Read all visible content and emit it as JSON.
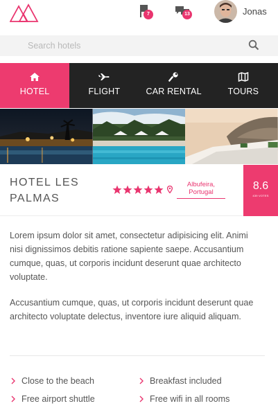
{
  "header": {
    "logo": "triangles-logo",
    "flag_badge": "7",
    "messages_badge": "13",
    "username": "Jonas"
  },
  "search": {
    "placeholder": "Search hotels"
  },
  "tabs": [
    {
      "label": "HOTEL",
      "icon": "home-icon",
      "active": true
    },
    {
      "label": "FLIGHT",
      "icon": "plane-icon",
      "active": false
    },
    {
      "label": "CAR RENTAL",
      "icon": "wrench-icon",
      "active": false
    },
    {
      "label": "TOURS",
      "icon": "map-icon",
      "active": false
    }
  ],
  "hotel": {
    "name": "HOTEL LES PALMAS",
    "stars": 5,
    "location": "Albufeira, Portugal",
    "score": "8.6",
    "votes_label": "439 VOTES"
  },
  "description": {
    "p1": "Lorem ipsum dolor sit amet, consectetur adipisicing elit. Animi nisi dignissimos debitis ratione sapiente saepe. Accusantium cumque, quas, ut corporis incidunt deserunt quae architecto voluptate.",
    "p2": "Accusantium cumque, quas, ut corporis incidunt deserunt quae architecto voluptate delectus, inventore iure aliquid aliquam."
  },
  "amenities": [
    "Close to the beach",
    "Breakfast included",
    "Free airport shuttle",
    "Free wifi in all rooms"
  ],
  "colors": {
    "accent": "#ed3b6f",
    "nav_bg": "#232323",
    "search_bg": "#f3f3f3"
  }
}
